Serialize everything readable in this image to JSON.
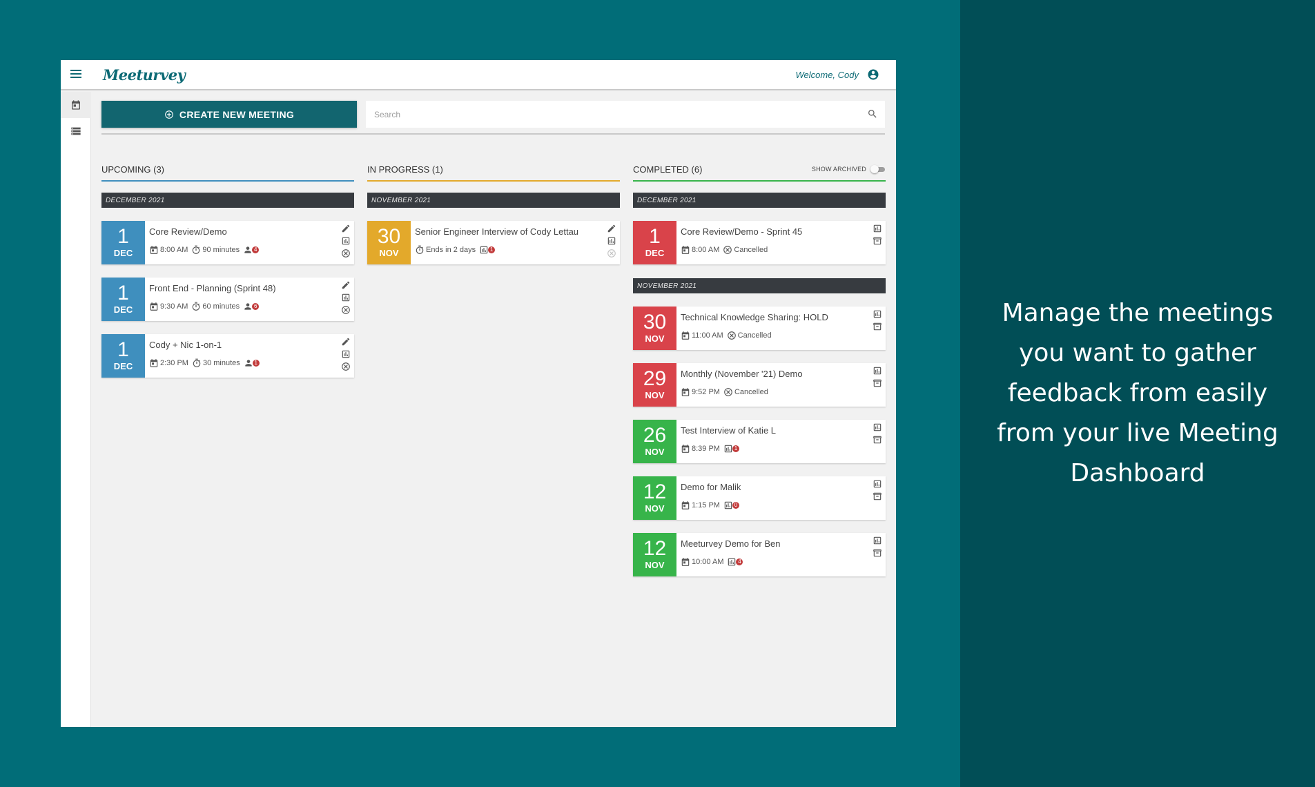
{
  "app": {
    "logo": "Meeturvey",
    "welcome": "Welcome, Cody",
    "create_button": "CREATE NEW MEETING",
    "search_placeholder": "Search"
  },
  "colors": {
    "upcoming": "#3f8fbe",
    "in_progress": "#e3a92b",
    "cancelled": "#d9434a",
    "completed": "#37b44a",
    "brand": "#12656f"
  },
  "columns": {
    "upcoming": {
      "title": "UPCOMING (3)",
      "month": "DECEMBER 2021",
      "cards": [
        {
          "day": "1",
          "mon": "DEC",
          "title": "Core Review/Demo",
          "time": "8:00 AM",
          "duration": "90 minutes",
          "count": "4"
        },
        {
          "day": "1",
          "mon": "DEC",
          "title": "Front End - Planning (Sprint 48)",
          "time": "9:30 AM",
          "duration": "60 minutes",
          "count": "6"
        },
        {
          "day": "1",
          "mon": "DEC",
          "title": "Cody + Nic 1-on-1",
          "time": "2:30 PM",
          "duration": "30 minutes",
          "count": "1"
        }
      ]
    },
    "in_progress": {
      "title": "IN PROGRESS (1)",
      "month": "NOVEMBER 2021",
      "cards": [
        {
          "day": "30",
          "mon": "NOV",
          "title": "Senior Engineer Interview of Cody Lettau",
          "ends": "Ends in 2 days",
          "count": "1"
        }
      ]
    },
    "completed": {
      "title": "COMPLETED (6)",
      "show_archived": "SHOW ARCHIVED",
      "show_archived_on": false,
      "month_dec": "DECEMBER 2021",
      "month_nov": "NOVEMBER 2021",
      "cards": [
        {
          "day": "1",
          "mon": "DEC",
          "title": "Core Review/Demo - Sprint 45",
          "time": "8:00 AM",
          "status": "Cancelled"
        },
        {
          "day": "30",
          "mon": "NOV",
          "title": "Technical Knowledge Sharing: HOLD",
          "time": "11:00 AM",
          "status": "Cancelled"
        },
        {
          "day": "29",
          "mon": "NOV",
          "title": "Monthly (November '21) Demo",
          "time": "9:52 PM",
          "status": "Cancelled"
        },
        {
          "day": "26",
          "mon": "NOV",
          "title": "Test Interview of Katie L",
          "time": "8:39 PM",
          "count": "1"
        },
        {
          "day": "12",
          "mon": "NOV",
          "title": "Demo for Malik",
          "time": "1:15 PM",
          "count": "0"
        },
        {
          "day": "12",
          "mon": "NOV",
          "title": "Meeturvey Demo for Ben",
          "time": "10:00 AM",
          "count": "4"
        }
      ]
    }
  },
  "tagline": "Manage the meetings you want to gather feedback from easily from your live Meeting Dashboard"
}
